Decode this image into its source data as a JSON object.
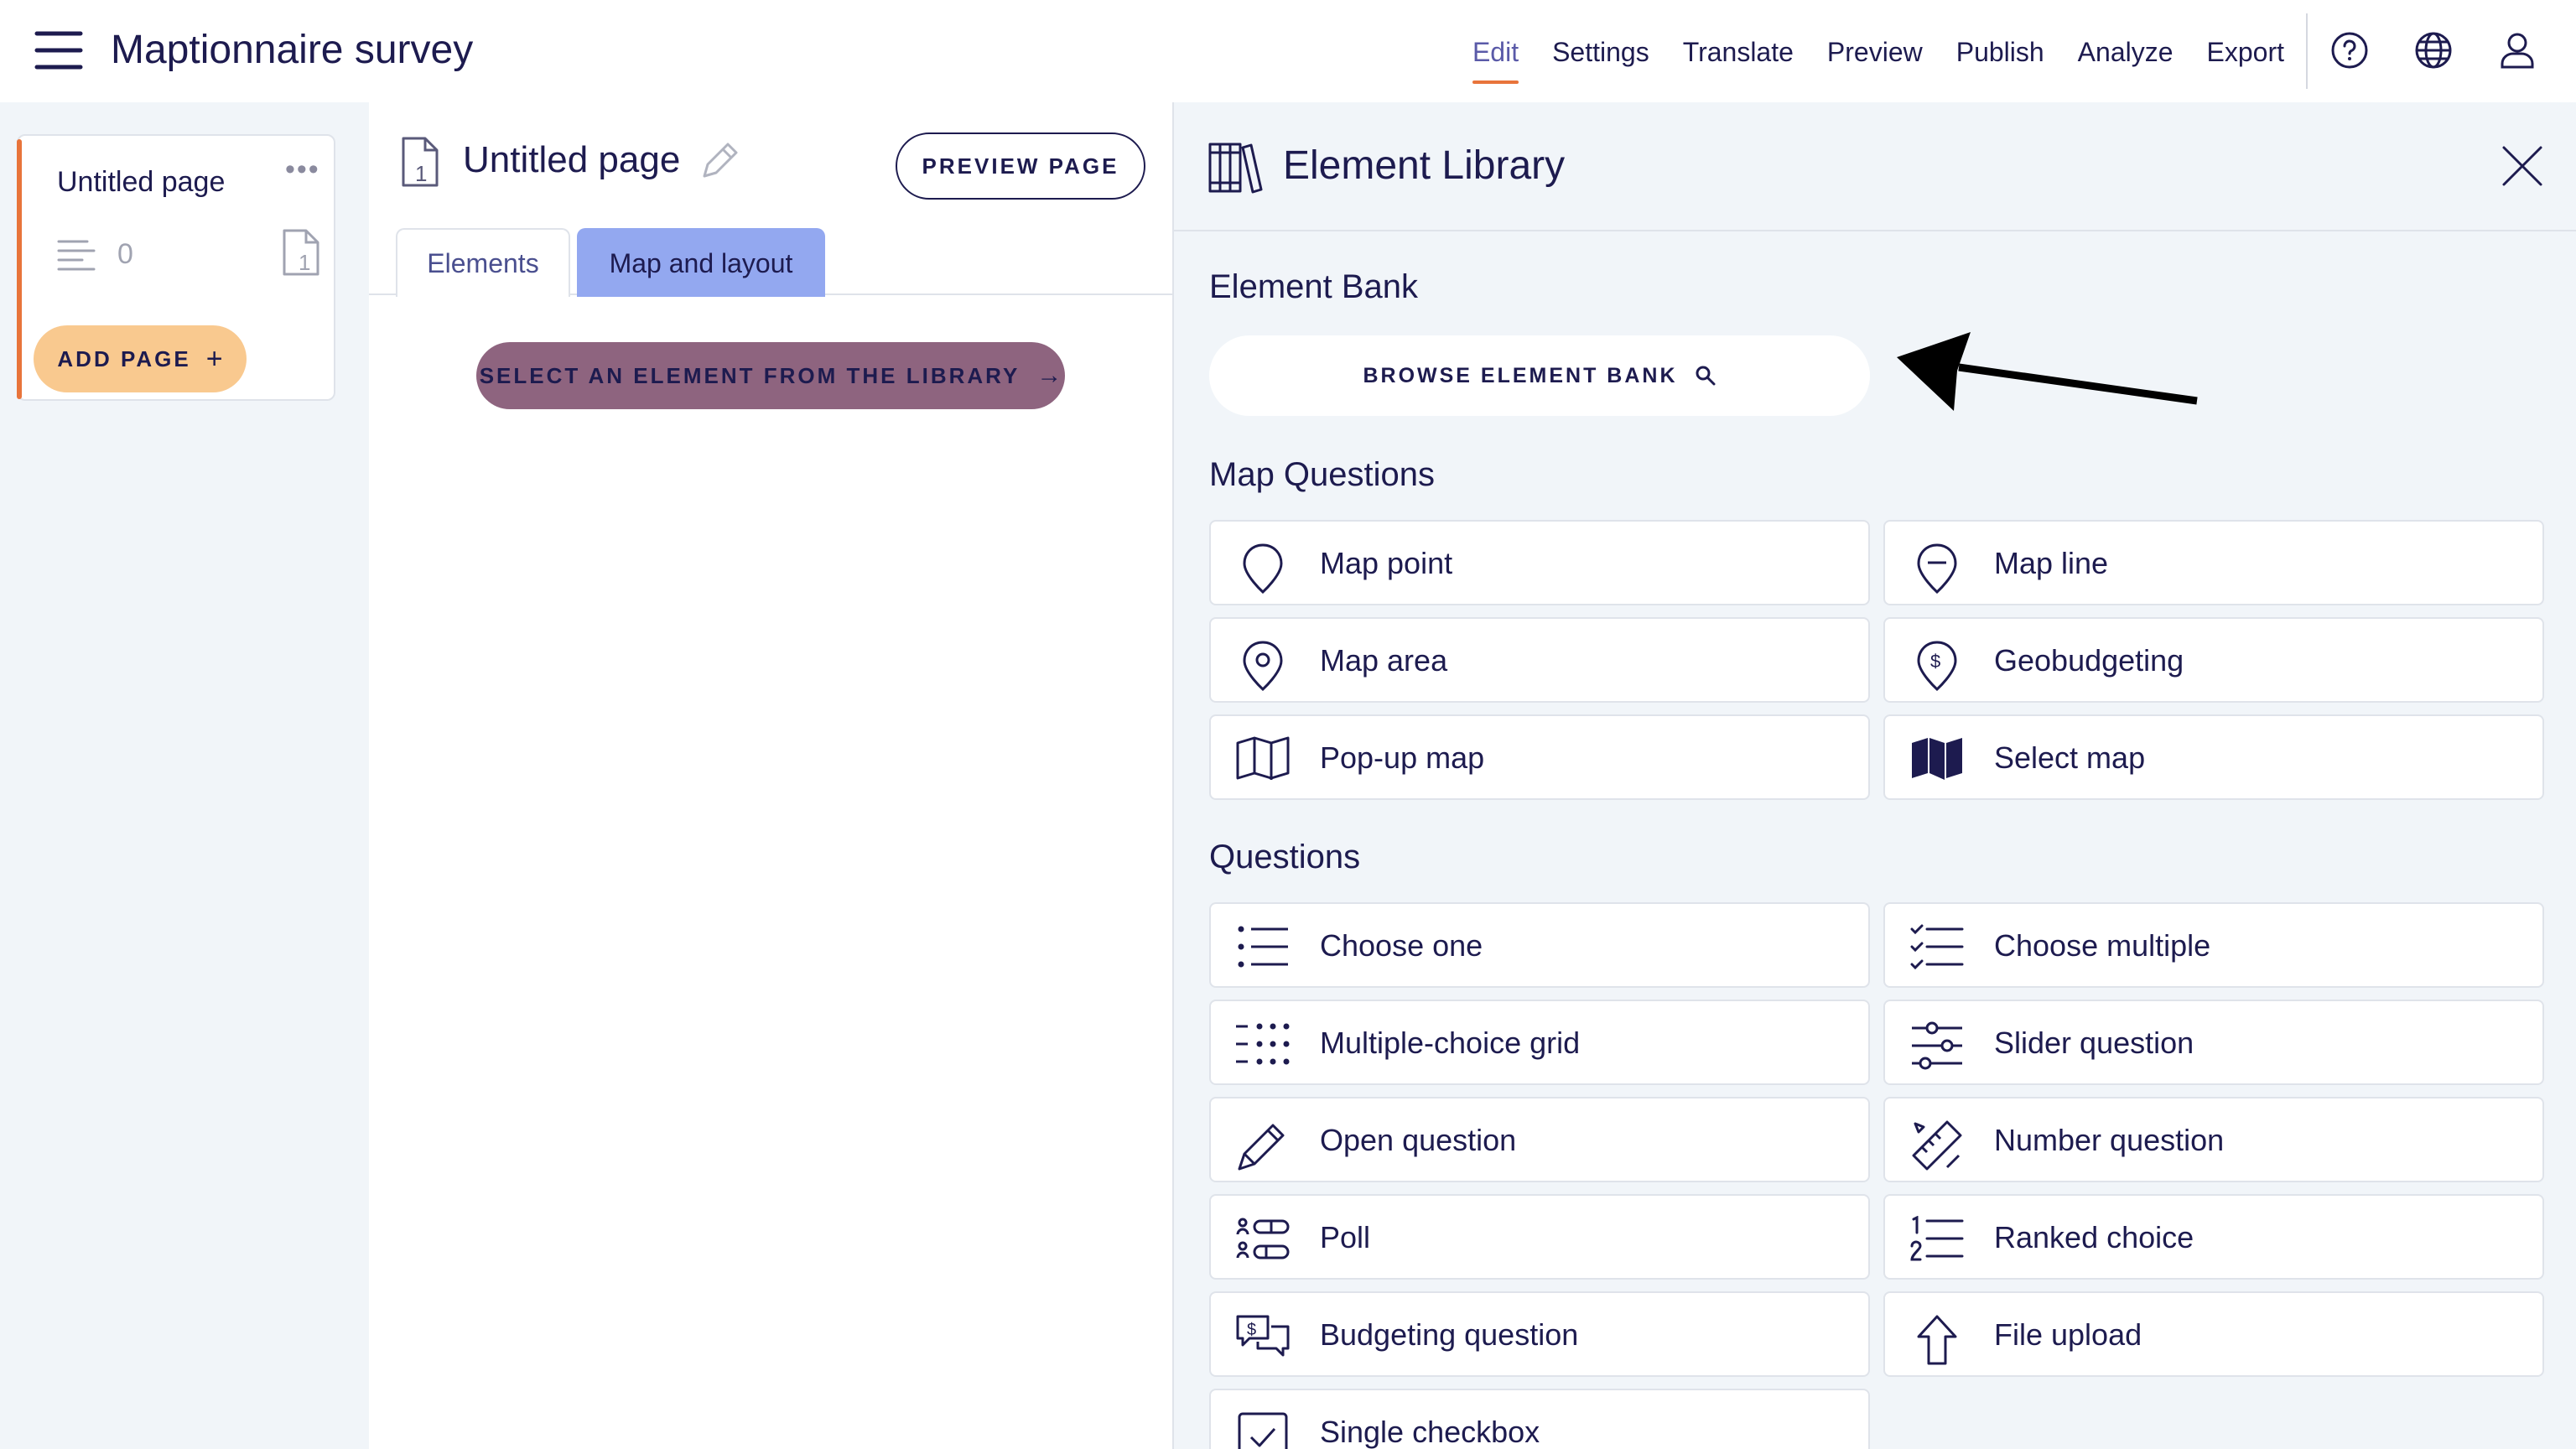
{
  "app": {
    "title": "Maptionnaire survey"
  },
  "topnav": [
    {
      "label": "Edit"
    },
    {
      "label": "Settings"
    },
    {
      "label": "Translate"
    },
    {
      "label": "Preview"
    },
    {
      "label": "Publish"
    },
    {
      "label": "Analyze"
    },
    {
      "label": "Export"
    }
  ],
  "topnav_active": "Edit",
  "pages": {
    "card": {
      "title": "Untitled page",
      "menu": "•••",
      "element_count": "0",
      "page_number": "1"
    },
    "add_page_label": "ADD PAGE",
    "add_page_icon": "+"
  },
  "editor": {
    "page_title": "Untitled page",
    "preview_button": "PREVIEW PAGE",
    "tabs": [
      {
        "label": "Elements"
      },
      {
        "label": "Map and layout"
      }
    ],
    "active_tab": "Map and layout",
    "select_button": "SELECT AN ELEMENT FROM THE LIBRARY",
    "select_arrow": "→"
  },
  "library": {
    "title": "Element Library",
    "element_bank_heading": "Element Bank",
    "browse_button": "BROWSE ELEMENT BANK",
    "map_questions_heading": "Map Questions",
    "map_questions": [
      {
        "label": "Map point",
        "icon": "map-pin-icon"
      },
      {
        "label": "Map line",
        "icon": "map-line-icon"
      },
      {
        "label": "Map area",
        "icon": "map-area-pin-icon"
      },
      {
        "label": "Geobudgeting",
        "icon": "geobudget-pin-icon"
      },
      {
        "label": "Pop-up map",
        "icon": "folded-map-outline-icon"
      },
      {
        "label": "Select map",
        "icon": "folded-map-filled-icon"
      }
    ],
    "questions_heading": "Questions",
    "questions": [
      {
        "label": "Choose one",
        "icon": "bullet-list-icon"
      },
      {
        "label": "Choose multiple",
        "icon": "checklist-icon"
      },
      {
        "label": "Multiple-choice grid",
        "icon": "dot-grid-icon"
      },
      {
        "label": "Slider question",
        "icon": "sliders-icon"
      },
      {
        "label": "Open question",
        "icon": "pencil-icon"
      },
      {
        "label": "Number question",
        "icon": "ruler-pencil-icon"
      },
      {
        "label": "Poll",
        "icon": "poll-icon"
      },
      {
        "label": "Ranked choice",
        "icon": "numbered-list-icon"
      },
      {
        "label": "Budgeting question",
        "icon": "budget-chat-icon"
      },
      {
        "label": "File upload",
        "icon": "upload-arrow-icon"
      },
      {
        "label": "Single checkbox",
        "icon": "checkbox-icon"
      }
    ]
  },
  "colors": {
    "navy": "#1d1b4f",
    "accent_orange": "#e8743b",
    "add_page_bg": "#f9c98f",
    "select_button_bg": "#8e647f",
    "active_tab_bg": "#93a8f0",
    "panel_bg": "#f1f5f9"
  }
}
